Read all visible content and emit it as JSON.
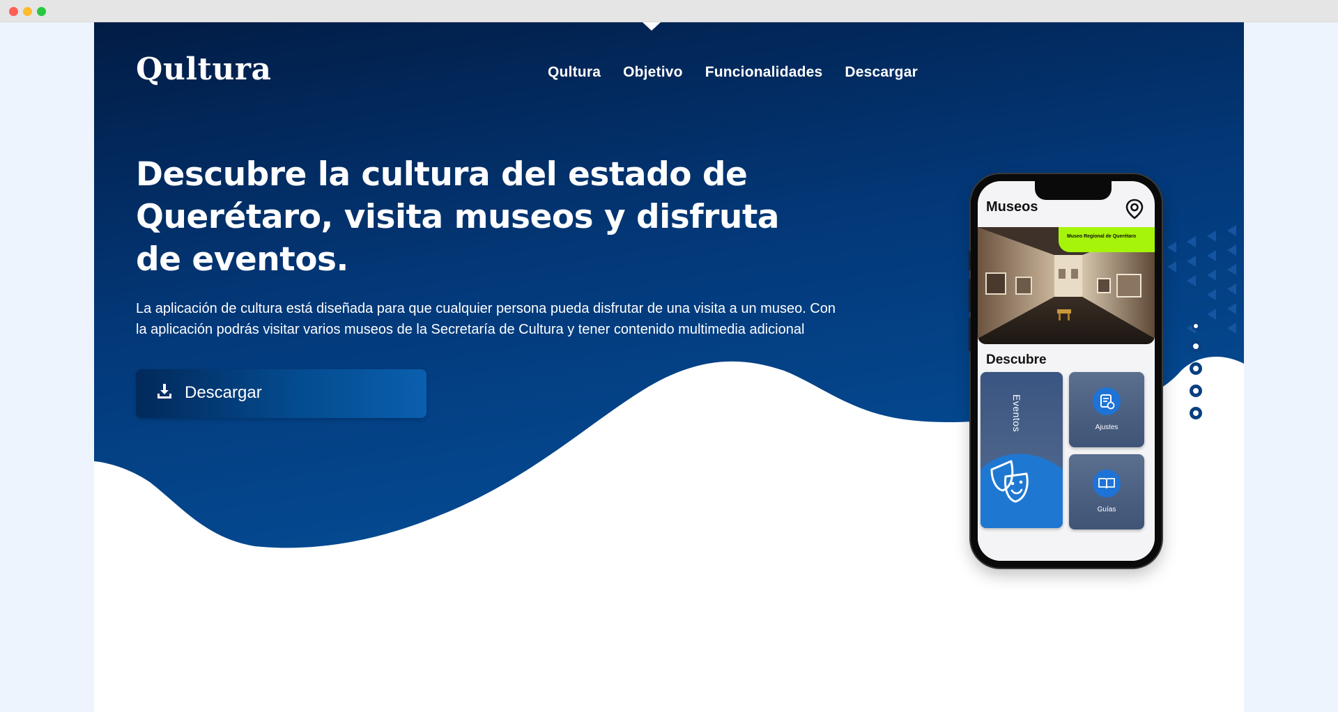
{
  "brand": {
    "logo": "Qultura"
  },
  "nav": {
    "items": [
      "Qultura",
      "Objetivo",
      "Funcionalidades",
      "Descargar"
    ]
  },
  "hero": {
    "headline": "Descubre la cultura del estado de Querétaro, visita museos y disfruta de eventos.",
    "description": "La aplicación de cultura está diseñada para que cualquier persona pueda disfrutar de una visita a un museo. Con la aplicación podrás visitar varios museos de la Secretaría de Cultura y tener contenido multimedia adicional",
    "cta_label": "Descargar",
    "cta_icon": "download-icon"
  },
  "phone": {
    "title": "Museos",
    "pin_icon": "location-pin-icon",
    "museum_tag": "Museo Regional de Querétaro",
    "section_title": "Descubre",
    "tiles": {
      "eventos": "Eventos",
      "ajustes": "Ajustes",
      "guias": "Guías"
    }
  },
  "slider": {
    "count": 5,
    "active_index": 0
  },
  "colors": {
    "hero_dark": "#021c45",
    "hero_mid": "#03397a",
    "accent_green": "#a6f409",
    "accent_blue": "#1e73d6",
    "page_bg": "#eef4fd"
  }
}
